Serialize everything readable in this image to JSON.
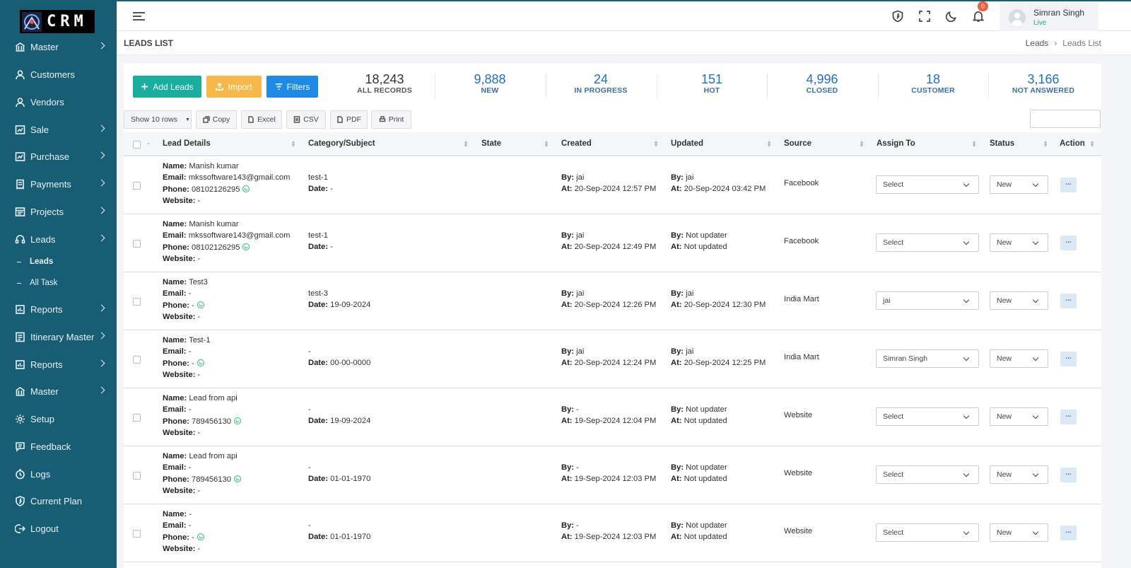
{
  "brand": {
    "logo_text": "CRM"
  },
  "sidebar": {
    "items": [
      {
        "label": "Master",
        "icon": "bank-icon",
        "chevron": true
      },
      {
        "label": "Customers",
        "icon": "user-icon",
        "chevron": false
      },
      {
        "label": "Vendors",
        "icon": "user-icon",
        "chevron": false
      },
      {
        "label": "Sale",
        "icon": "chart-icon",
        "chevron": true
      },
      {
        "label": "Purchase",
        "icon": "cart-icon",
        "chevron": true
      },
      {
        "label": "Payments",
        "icon": "receipt-icon",
        "chevron": true
      },
      {
        "label": "Projects",
        "icon": "project-icon",
        "chevron": true
      },
      {
        "label": "Leads",
        "icon": "headset-icon",
        "chevron": true
      },
      {
        "label": "Reports",
        "icon": "report-icon",
        "chevron": true
      },
      {
        "label": "Itinerary Master",
        "icon": "itinerary-icon",
        "chevron": true
      },
      {
        "label": "Reports",
        "icon": "report-icon",
        "chevron": true
      },
      {
        "label": "Master",
        "icon": "bank-icon",
        "chevron": true
      },
      {
        "label": "Setup",
        "icon": "gear-icon",
        "chevron": false
      },
      {
        "label": "Feedback",
        "icon": "feedback-icon",
        "chevron": false
      },
      {
        "label": "Logs",
        "icon": "logs-icon",
        "chevron": false
      },
      {
        "label": "Current Plan",
        "icon": "shield-icon",
        "chevron": false
      },
      {
        "label": "Logout",
        "icon": "logout-icon",
        "chevron": false
      }
    ],
    "sub_items": [
      {
        "label": "Leads",
        "active": true
      },
      {
        "label": "All Task",
        "active": false
      }
    ]
  },
  "topbar": {
    "notification_count": "0",
    "user_name": "Simran Singh",
    "user_status": "Live"
  },
  "page": {
    "title": "LEADS LIST",
    "breadcrumb": [
      "Leads",
      "Leads List"
    ]
  },
  "actions": {
    "add_label": "Add Leads",
    "import_label": "Import",
    "filters_label": "Filters"
  },
  "stats": [
    {
      "value": "18,243",
      "label": "ALL RECORDS"
    },
    {
      "value": "9,888",
      "label": "NEW"
    },
    {
      "value": "24",
      "label": "IN PROGRESS"
    },
    {
      "value": "151",
      "label": "HOT"
    },
    {
      "value": "4,996",
      "label": "CLOSED"
    },
    {
      "value": "18",
      "label": "CUSTOMER"
    },
    {
      "value": "3,166",
      "label": "NOT ANSWERED"
    }
  ],
  "export": {
    "rows_label": "Show 10 rows",
    "copy": "Copy",
    "excel": "Excel",
    "csv": "CSV",
    "pdf": "PDF",
    "print": "Print"
  },
  "search": {
    "value": ""
  },
  "table": {
    "headers": [
      "Lead Details",
      "Category/Subject",
      "State",
      "Created",
      "Updated",
      "Source",
      "Assign To",
      "Status",
      "Action"
    ],
    "field_labels": {
      "name": "Name:",
      "email": "Email:",
      "phone": "Phone:",
      "website": "Website:",
      "date": "Date:",
      "by": "By:",
      "at": "At:"
    },
    "rows": [
      {
        "name": "Manish kumar",
        "email": "mkssoftware143@gmail.com",
        "phone": "08102126295",
        "website": "-",
        "subject": "test-1",
        "date": "-",
        "state": "",
        "created_by": "jai",
        "created_at": "20-Sep-2024 12:57 PM",
        "updated_by": "jai",
        "updated_at": "20-Sep-2024 03:42 PM",
        "source": "Facebook",
        "assign": "Select",
        "status": "New",
        "action": "..."
      },
      {
        "name": "Manish kumar",
        "email": "mkssoftware143@gmail.com",
        "phone": "08102126295",
        "website": "-",
        "subject": "test-1",
        "date": "-",
        "state": "",
        "created_by": "jai",
        "created_at": "20-Sep-2024 12:49 PM",
        "updated_by": "Not updater",
        "updated_at": "Not updated",
        "source": "Facebook",
        "assign": "Select",
        "status": "New",
        "action": "..."
      },
      {
        "name": "Test3",
        "email": "-",
        "phone": "-",
        "website": "-",
        "subject": "test-3",
        "date": "19-09-2024",
        "state": "",
        "created_by": "jai",
        "created_at": "20-Sep-2024 12:26 PM",
        "updated_by": "jai",
        "updated_at": "20-Sep-2024 12:30 PM",
        "source": "India Mart",
        "assign": "jai",
        "status": "New",
        "action": "..."
      },
      {
        "name": "Test-1",
        "email": "-",
        "phone": "-",
        "website": "-",
        "subject": "-",
        "date": "00-00-0000",
        "state": "",
        "created_by": "jai",
        "created_at": "20-Sep-2024 12:24 PM",
        "updated_by": "jai",
        "updated_at": "20-Sep-2024 12:25 PM",
        "source": "India Mart",
        "assign": "Simran Singh",
        "status": "New",
        "action": "..."
      },
      {
        "name": "Lead from api",
        "email": "-",
        "phone": "789456130",
        "website": "-",
        "subject": "-",
        "date": "19-09-2024",
        "state": "",
        "created_by": "-",
        "created_at": "19-Sep-2024 12:04 PM",
        "updated_by": "Not updater",
        "updated_at": "Not updated",
        "source": "Website",
        "assign": "Select",
        "status": "New",
        "action": "..."
      },
      {
        "name": "Lead from api",
        "email": "-",
        "phone": "789456130",
        "website": "-",
        "subject": "-",
        "date": "01-01-1970",
        "state": "",
        "created_by": "-",
        "created_at": "19-Sep-2024 12:03 PM",
        "updated_by": "Not updater",
        "updated_at": "Not updated",
        "source": "Website",
        "assign": "Select",
        "status": "New",
        "action": "..."
      },
      {
        "name": "-",
        "email": "-",
        "phone": "-",
        "website": "-",
        "subject": "-",
        "date": "01-01-1970",
        "state": "",
        "created_by": "-",
        "created_at": "19-Sep-2024 12:03 PM",
        "updated_by": "Not updater",
        "updated_at": "Not updated",
        "source": "Website",
        "assign": "Select",
        "status": "New",
        "action": "..."
      }
    ]
  },
  "colors": {
    "sidebar": "#175d73",
    "add_button": "#1aae9f",
    "import_button": "#f7b84b",
    "filters_button": "#1e8ae6",
    "stat_blue": "#1e6fd0"
  }
}
